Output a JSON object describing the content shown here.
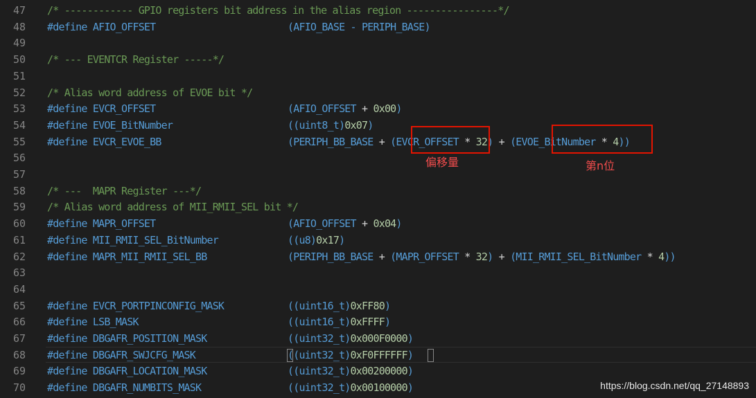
{
  "editor": {
    "lines": [
      {
        "n": "47",
        "parts": [
          {
            "t": "/* ------------ GPIO registers bit address in the alias region ----------------*/",
            "c": "cmt"
          }
        ]
      },
      {
        "n": "48",
        "parts": [
          {
            "t": "#define",
            "c": "kw"
          },
          {
            "t": " AFIO_OFFSET",
            "c": "mac"
          },
          {
            "t": "(AFIO_BASE - PERIPH_BASE)",
            "c": "mac",
            "col": 1
          }
        ]
      },
      {
        "n": "49",
        "parts": []
      },
      {
        "n": "50",
        "parts": [
          {
            "t": "/* --- EVENTCR Register -----*/",
            "c": "cmt"
          }
        ]
      },
      {
        "n": "51",
        "parts": []
      },
      {
        "n": "52",
        "parts": [
          {
            "t": "/* Alias word address of EVOE bit */",
            "c": "cmt"
          }
        ]
      },
      {
        "n": "53",
        "parts": [
          {
            "t": "#define",
            "c": "kw"
          },
          {
            "t": " EVCR_OFFSET",
            "c": "mac"
          },
          {
            "t": "(AFIO_OFFSET ",
            "c": "mac",
            "col": 1
          },
          {
            "t": "+ ",
            "c": "op"
          },
          {
            "t": "0x00",
            "c": "num"
          },
          {
            "t": ")",
            "c": "mac"
          }
        ]
      },
      {
        "n": "54",
        "parts": [
          {
            "t": "#define",
            "c": "kw"
          },
          {
            "t": " EVOE_BitNumber",
            "c": "mac"
          },
          {
            "t": "((uint8_t)",
            "c": "mac",
            "col": 1
          },
          {
            "t": "0x07",
            "c": "num"
          },
          {
            "t": ")",
            "c": "mac"
          }
        ]
      },
      {
        "n": "55",
        "parts": [
          {
            "t": "#define",
            "c": "kw"
          },
          {
            "t": " EVCR_EVOE_BB",
            "c": "mac"
          },
          {
            "t": "(PERIPH_BB_BASE ",
            "c": "mac",
            "col": 1
          },
          {
            "t": "+ ",
            "c": "op"
          },
          {
            "t": "(EVCR_OFFSET ",
            "c": "mac"
          },
          {
            "t": "* ",
            "c": "op"
          },
          {
            "t": "32",
            "c": "num"
          },
          {
            "t": ") ",
            "c": "mac"
          },
          {
            "t": "+ ",
            "c": "op"
          },
          {
            "t": "(EVOE_BitNumber ",
            "c": "mac"
          },
          {
            "t": "* ",
            "c": "op"
          },
          {
            "t": "4",
            "c": "num"
          },
          {
            "t": "))",
            "c": "mac"
          }
        ]
      },
      {
        "n": "56",
        "parts": []
      },
      {
        "n": "57",
        "parts": []
      },
      {
        "n": "58",
        "parts": [
          {
            "t": "/* ---  MAPR Register ---*/",
            "c": "cmt"
          }
        ]
      },
      {
        "n": "59",
        "parts": [
          {
            "t": "/* Alias word address of MII_RMII_SEL bit */",
            "c": "cmt"
          }
        ]
      },
      {
        "n": "60",
        "parts": [
          {
            "t": "#define",
            "c": "kw"
          },
          {
            "t": " MAPR_OFFSET",
            "c": "mac"
          },
          {
            "t": "(AFIO_OFFSET ",
            "c": "mac",
            "col": 1
          },
          {
            "t": "+ ",
            "c": "op"
          },
          {
            "t": "0x04",
            "c": "num"
          },
          {
            "t": ")",
            "c": "mac"
          }
        ]
      },
      {
        "n": "61",
        "parts": [
          {
            "t": "#define",
            "c": "kw"
          },
          {
            "t": " MII_RMII_SEL_BitNumber",
            "c": "mac"
          },
          {
            "t": "((u8)",
            "c": "mac",
            "col": 1
          },
          {
            "t": "0x17",
            "c": "num"
          },
          {
            "t": ")",
            "c": "mac"
          }
        ]
      },
      {
        "n": "62",
        "parts": [
          {
            "t": "#define",
            "c": "kw"
          },
          {
            "t": " MAPR_MII_RMII_SEL_BB",
            "c": "mac"
          },
          {
            "t": "(PERIPH_BB_BASE ",
            "c": "mac",
            "col": 1
          },
          {
            "t": "+ ",
            "c": "op"
          },
          {
            "t": "(MAPR_OFFSET ",
            "c": "mac"
          },
          {
            "t": "* ",
            "c": "op"
          },
          {
            "t": "32",
            "c": "num"
          },
          {
            "t": ") ",
            "c": "mac"
          },
          {
            "t": "+ ",
            "c": "op"
          },
          {
            "t": "(MII_RMII_SEL_BitNumber ",
            "c": "mac"
          },
          {
            "t": "* ",
            "c": "op"
          },
          {
            "t": "4",
            "c": "num"
          },
          {
            "t": "))",
            "c": "mac"
          }
        ]
      },
      {
        "n": "63",
        "parts": []
      },
      {
        "n": "64",
        "parts": []
      },
      {
        "n": "65",
        "parts": [
          {
            "t": "#define",
            "c": "kw"
          },
          {
            "t": " EVCR_PORTPINCONFIG_MASK",
            "c": "mac"
          },
          {
            "t": "((uint16_t)",
            "c": "mac",
            "col": 1
          },
          {
            "t": "0xFF80",
            "c": "num"
          },
          {
            "t": ")",
            "c": "mac"
          }
        ]
      },
      {
        "n": "66",
        "parts": [
          {
            "t": "#define",
            "c": "kw"
          },
          {
            "t": " LSB_MASK",
            "c": "mac"
          },
          {
            "t": "((uint16_t)",
            "c": "mac",
            "col": 1
          },
          {
            "t": "0xFFFF",
            "c": "num"
          },
          {
            "t": ")",
            "c": "mac"
          }
        ]
      },
      {
        "n": "67",
        "parts": [
          {
            "t": "#define",
            "c": "kw"
          },
          {
            "t": " DBGAFR_POSITION_MASK",
            "c": "mac"
          },
          {
            "t": "((uint32_t)",
            "c": "mac",
            "col": 1
          },
          {
            "t": "0x000F0000",
            "c": "num"
          },
          {
            "t": ")",
            "c": "mac"
          }
        ]
      },
      {
        "n": "68",
        "parts": [
          {
            "t": "#define",
            "c": "kw"
          },
          {
            "t": " DBGAFR_SWJCFG_MASK",
            "c": "mac"
          },
          {
            "t": "((uint32_t)",
            "c": "mac",
            "col": 1
          },
          {
            "t": "0xF0FFFFFF",
            "c": "num"
          },
          {
            "t": ")",
            "c": "mac"
          }
        ]
      },
      {
        "n": "69",
        "parts": [
          {
            "t": "#define",
            "c": "kw"
          },
          {
            "t": " DBGAFR_LOCATION_MASK",
            "c": "mac"
          },
          {
            "t": "((uint32_t)",
            "c": "mac",
            "col": 1
          },
          {
            "t": "0x00200000",
            "c": "num"
          },
          {
            "t": ")",
            "c": "mac"
          }
        ]
      },
      {
        "n": "70",
        "parts": [
          {
            "t": "#define",
            "c": "kw"
          },
          {
            "t": " DBGAFR_NUMBITS_MASK",
            "c": "mac"
          },
          {
            "t": "((uint32_t)",
            "c": "mac",
            "col": 1
          },
          {
            "t": "0x00100000",
            "c": "num"
          },
          {
            "t": ")",
            "c": "mac"
          }
        ]
      }
    ]
  },
  "annotations": {
    "offset_label": "偏移量",
    "bit_label": "第n位"
  },
  "watermark": "https://blog.csdn.net/qq_27148893",
  "colors": {
    "background": "#1e1e1e",
    "comment": "#6a9955",
    "keyword": "#569cd6",
    "number": "#b5cea8",
    "line_number": "#858585",
    "annotation": "#e51400"
  }
}
